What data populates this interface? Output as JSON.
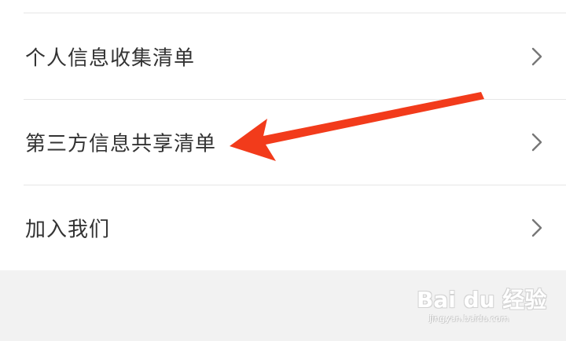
{
  "menu": {
    "items": [
      {
        "label": "个人信息收集清单"
      },
      {
        "label": "第三方信息共享清单"
      },
      {
        "label": "加入我们"
      }
    ]
  },
  "annotation": {
    "arrow_color": "#f23b1b"
  },
  "watermark": {
    "logo_text": "Bai du 经验",
    "url_text": "jingyan.baidu.com"
  },
  "colors": {
    "text": "#333333",
    "chevron": "#777777",
    "divider": "#e6e6e6",
    "background": "#f2f2f2"
  }
}
